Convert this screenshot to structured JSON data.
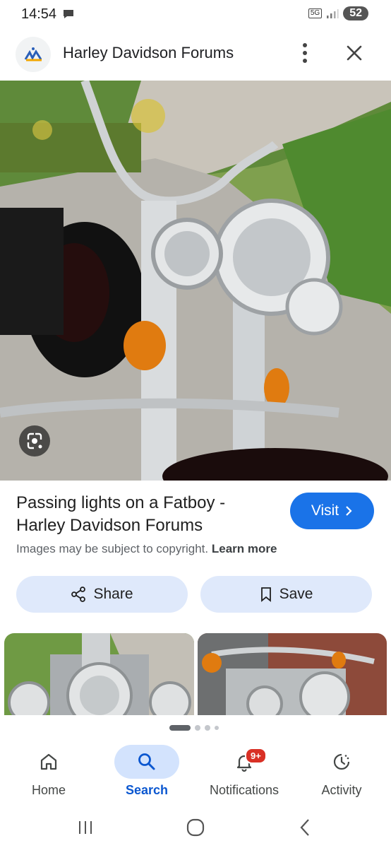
{
  "status_bar": {
    "time": "14:54",
    "network": "5G",
    "battery": "52"
  },
  "header": {
    "title": "Harley Davidson Forums",
    "favicon": "harley-davidson-forums-logo",
    "menu_icon": "more-vert-icon",
    "close_icon": "close-icon"
  },
  "result": {
    "title": "Passing lights on a Fatboy - Harley Davidson Forums",
    "visit_label": "Visit",
    "copyright_text": "Images may be subject to copyright.",
    "learn_more": "Learn more",
    "share_label": "Share",
    "save_label": "Save"
  },
  "bottom_nav": {
    "items": [
      {
        "label": "Home",
        "icon": "home-icon"
      },
      {
        "label": "Search",
        "icon": "search-icon"
      },
      {
        "label": "Notifications",
        "icon": "bell-icon",
        "badge": "9+"
      },
      {
        "label": "Activity",
        "icon": "activity-icon"
      }
    ]
  },
  "colors": {
    "accent": "#1a73e8",
    "pill": "#dfe9fb",
    "active_nav": "#d3e3fd",
    "badge": "#d93025"
  }
}
